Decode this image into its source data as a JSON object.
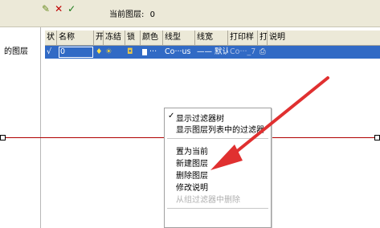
{
  "toolbar": {
    "icons": [
      "new-layer-icon",
      "delete-layer-icon",
      "set-current-icon"
    ],
    "current_layer_label": "当前图层:",
    "current_layer_value": "0"
  },
  "left_panel": {
    "label": "的图层"
  },
  "grid": {
    "headers": [
      "状",
      "名称",
      "开",
      "冻结",
      "锁",
      "颜色",
      "线型",
      "线宽",
      "打印样",
      "打",
      "说明"
    ],
    "row": {
      "status": "√",
      "name": "0",
      "linetype": "Co···us",
      "lineweight": "—— 默认",
      "plotstyle": "Co···_7"
    }
  },
  "context_menu": {
    "items": [
      {
        "label": "显示过滤器树",
        "checked": true,
        "disabled": false
      },
      {
        "label": "显示图层列表中的过滤器",
        "checked": false,
        "disabled": false
      },
      {
        "label": "置为当前",
        "checked": false,
        "disabled": false
      },
      {
        "label": "新建图层",
        "checked": false,
        "disabled": false
      },
      {
        "label": "删除图层",
        "checked": false,
        "disabled": false
      },
      {
        "label": "修改说明",
        "checked": false,
        "disabled": false
      },
      {
        "label": "从组过滤器中删除",
        "checked": false,
        "disabled": true
      }
    ]
  },
  "colors": {
    "selection": "#316ac5",
    "arrow": "#e03030",
    "line": "#b00000"
  }
}
